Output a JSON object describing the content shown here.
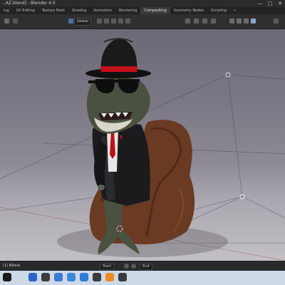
{
  "window": {
    "title": "...AZ.blend] - Blender 4.0",
    "controls": {
      "minimize": "—",
      "maximize": "▢",
      "close": "✕"
    }
  },
  "menubar": {
    "tabs": [
      {
        "label": "ing",
        "active": false
      },
      {
        "label": "UV Editing",
        "active": false
      },
      {
        "label": "Texture Paint",
        "active": false
      },
      {
        "label": "Shading",
        "active": false
      },
      {
        "label": "Animation",
        "active": false
      },
      {
        "label": "Rendering",
        "active": false
      },
      {
        "label": "Compositing",
        "active": true
      },
      {
        "label": "Geometry Nodes",
        "active": false
      },
      {
        "label": "Scripting",
        "active": false
      }
    ],
    "add_tab": "+"
  },
  "header": {
    "transform_orientation": "Global"
  },
  "timeline": {
    "left_label": "(1) Nikola",
    "playback_label": "Start",
    "end_label": "End"
  },
  "taskbar": {
    "icons": [
      "windows-icon",
      "search-icon",
      "file-explorer-icon",
      "browser-icon",
      "mail-icon",
      "store-icon",
      "edge-icon",
      "chrome-icon",
      "blender-icon",
      "app-icon"
    ]
  },
  "colors": {
    "hat": "#1a1a1a",
    "hat_band": "#c0101a",
    "suit": "#1b1b1e",
    "shark_skin": "#4a5140",
    "rock": "#6a3a22"
  }
}
